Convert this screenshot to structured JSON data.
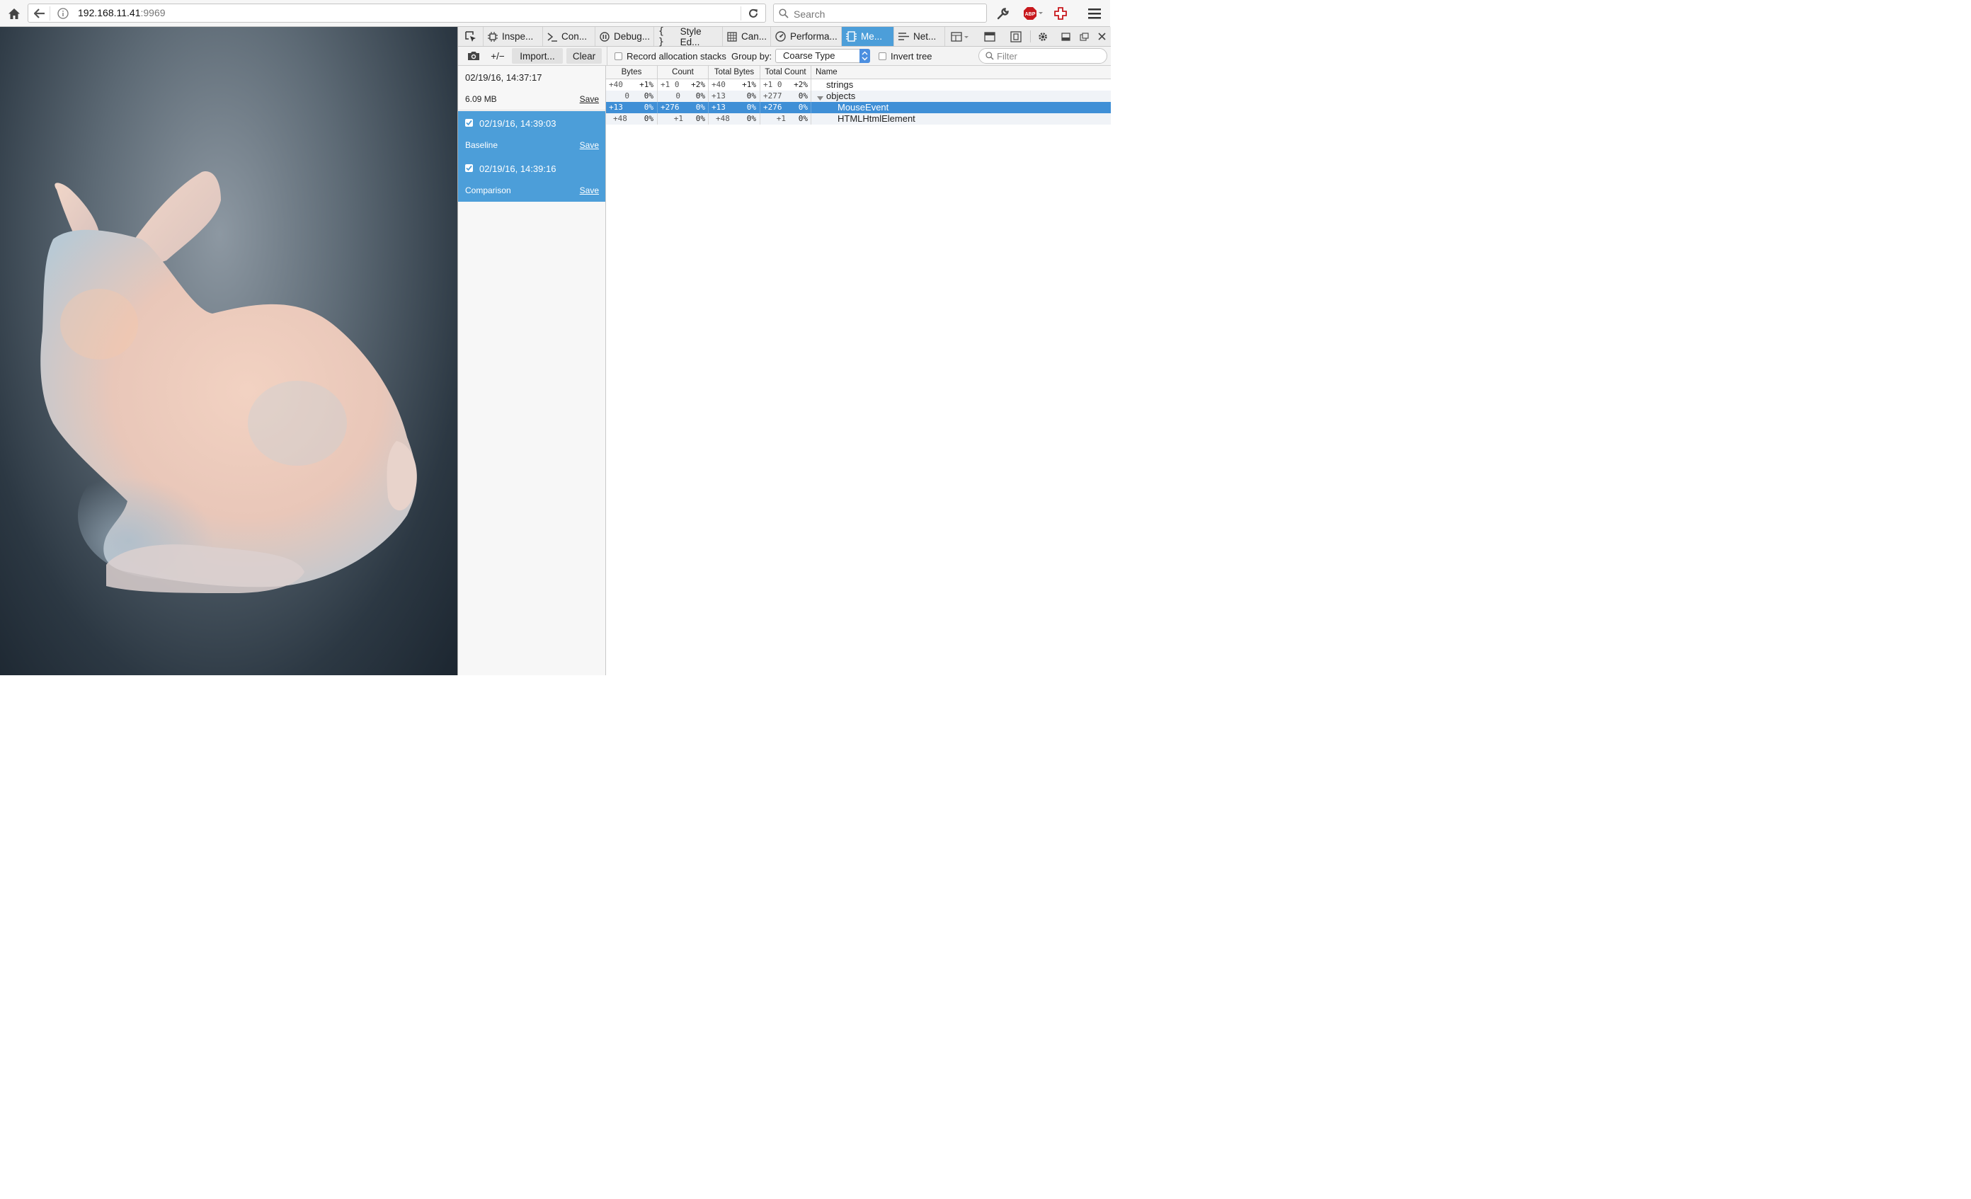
{
  "browser": {
    "url_host": "192.168.11.41",
    "url_port": ":9969",
    "search_placeholder": "Search"
  },
  "devtools": {
    "tabs": [
      {
        "label": "Inspe...",
        "icon": "inspector-icon"
      },
      {
        "label": "Con...",
        "icon": "console-icon"
      },
      {
        "label": "Debug...",
        "icon": "debugger-icon"
      },
      {
        "label": "Style Ed...",
        "icon": "style-editor-icon"
      },
      {
        "label": "Can...",
        "icon": "canvas-icon"
      },
      {
        "label": "Performa...",
        "icon": "performance-icon"
      },
      {
        "label": "Me...",
        "icon": "memory-icon",
        "selected": true
      },
      {
        "label": "Net...",
        "icon": "network-icon"
      }
    ]
  },
  "memory": {
    "toolbar": {
      "diff_label": "+/−",
      "import_label": "Import...",
      "clear_label": "Clear",
      "record_label": "Record allocation stacks",
      "group_by_label": "Group by:",
      "group_by_value": "Coarse Type",
      "invert_label": "Invert tree",
      "filter_placeholder": "Filter"
    },
    "snapshots": [
      {
        "date": "02/19/16, 14:37:17",
        "sub": "6.09 MB",
        "save": "Save"
      },
      {
        "date": "02/19/16, 14:39:03",
        "sub": "Baseline",
        "save": "Save"
      },
      {
        "date": "02/19/16, 14:39:16",
        "sub": "Comparison",
        "save": "Save"
      }
    ],
    "columns": [
      "Bytes",
      "Count",
      "Total Bytes",
      "Total Count",
      "Name"
    ],
    "rows": [
      {
        "bytes": "+40",
        "bytes_pct": "+1%",
        "count": "+1 0",
        "count_pct": "+2%",
        "total_bytes": "+40",
        "total_bytes_pct": "+1%",
        "total_count": "+1 0",
        "total_count_pct": "+2%",
        "name": "strings",
        "twisty": ""
      },
      {
        "bytes": "0",
        "bytes_pct": "0%",
        "count": "0",
        "count_pct": "0%",
        "total_bytes": "+13",
        "total_bytes_pct": "0%",
        "total_count": "+277",
        "total_count_pct": "0%",
        "name": "objects",
        "twisty": "open"
      },
      {
        "bytes": "+13",
        "bytes_pct": "0%",
        "count": "+276",
        "count_pct": "0%",
        "total_bytes": "+13",
        "total_bytes_pct": "0%",
        "total_count": "+276",
        "total_count_pct": "0%",
        "name": "MouseEvent",
        "twisty": ""
      },
      {
        "bytes": "+48",
        "bytes_pct": "0%",
        "count": "+1",
        "count_pct": "0%",
        "total_bytes": "+48",
        "total_bytes_pct": "0%",
        "total_count": "+1",
        "total_count_pct": "0%",
        "name": "HTMLHtmlElement",
        "twisty": ""
      }
    ]
  }
}
